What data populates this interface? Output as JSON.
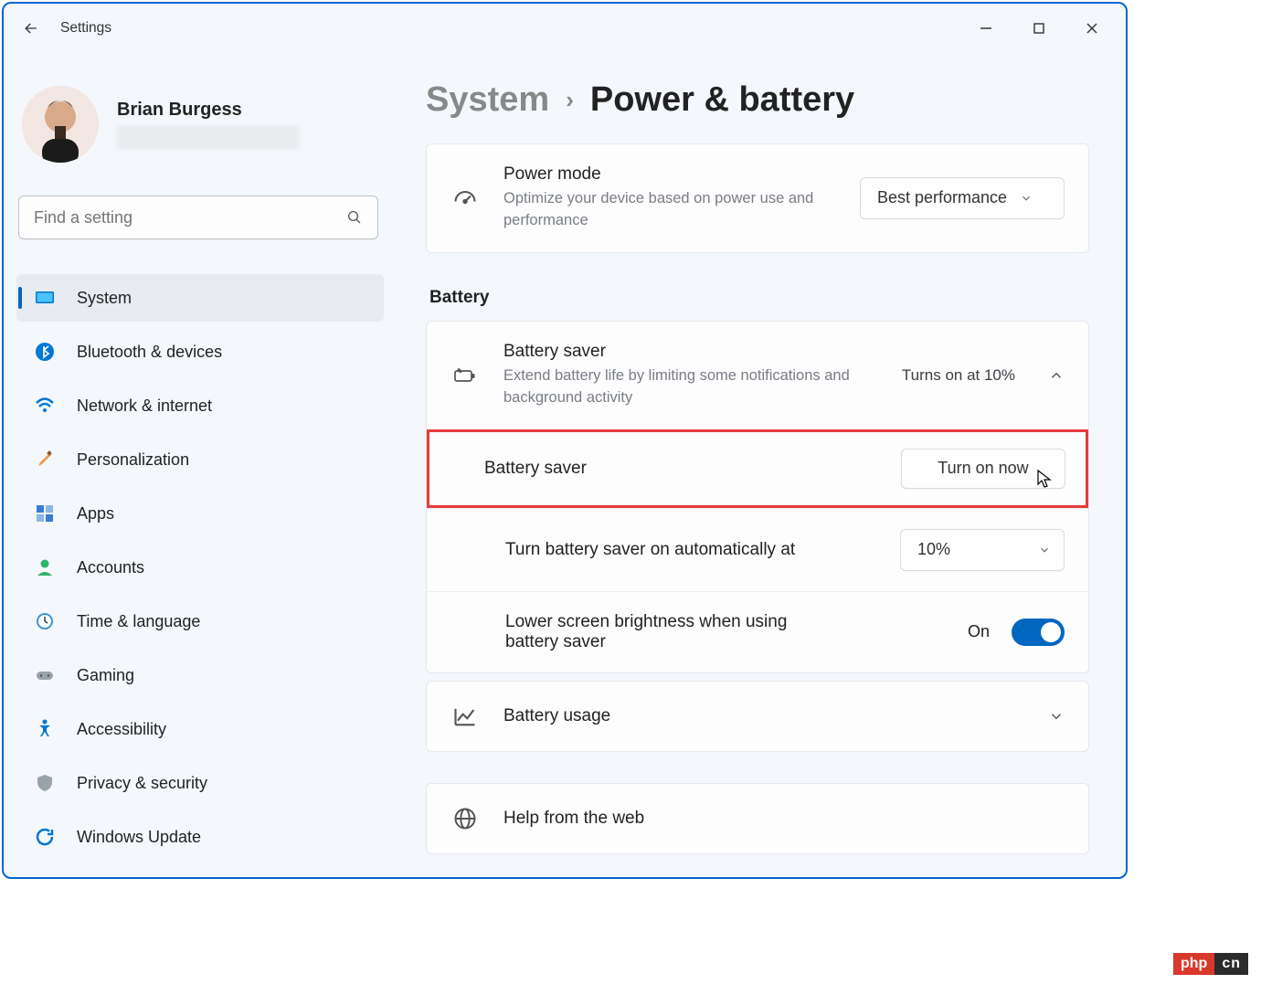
{
  "app_title": "Settings",
  "user": {
    "name": "Brian Burgess"
  },
  "search": {
    "placeholder": "Find a setting"
  },
  "sidebar": {
    "items": [
      {
        "label": "System"
      },
      {
        "label": "Bluetooth & devices"
      },
      {
        "label": "Network & internet"
      },
      {
        "label": "Personalization"
      },
      {
        "label": "Apps"
      },
      {
        "label": "Accounts"
      },
      {
        "label": "Time & language"
      },
      {
        "label": "Gaming"
      },
      {
        "label": "Accessibility"
      },
      {
        "label": "Privacy & security"
      },
      {
        "label": "Windows Update"
      }
    ]
  },
  "breadcrumb": {
    "parent": "System",
    "current": "Power & battery"
  },
  "power_mode": {
    "title": "Power mode",
    "subtitle": "Optimize your device based on power use and performance",
    "value": "Best performance"
  },
  "battery_section": "Battery",
  "battery_saver_header": {
    "title": "Battery saver",
    "subtitle": "Extend battery life by limiting some notifications and background activity",
    "status": "Turns on at 10%"
  },
  "battery_saver_row": {
    "title": "Battery saver",
    "button": "Turn on now"
  },
  "auto_row": {
    "title": "Turn battery saver on automatically at",
    "value": "10%"
  },
  "brightness_row": {
    "title": "Lower screen brightness when using battery saver",
    "state": "On"
  },
  "battery_usage": {
    "title": "Battery usage"
  },
  "help": {
    "title": "Help from the web"
  },
  "watermark": {
    "a": "php",
    "b": "cn"
  }
}
